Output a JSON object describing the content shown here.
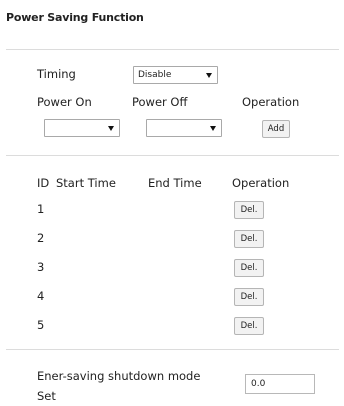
{
  "page": {
    "title": "Power Saving Function"
  },
  "timing": {
    "label": "Timing",
    "selected": "Disable"
  },
  "add_section": {
    "power_on_label": "Power On",
    "power_off_label": "Power Off",
    "operation_label": "Operation",
    "power_on_value": "",
    "power_off_value": "",
    "add_label": "Add"
  },
  "schedule_table": {
    "headers": {
      "id": "ID",
      "start_time": "Start Time",
      "end_time": "End Time",
      "operation": "Operation"
    },
    "rows": [
      {
        "id": "1",
        "del_label": "Del."
      },
      {
        "id": "2",
        "del_label": "Del."
      },
      {
        "id": "3",
        "del_label": "Del."
      },
      {
        "id": "4",
        "del_label": "Del."
      },
      {
        "id": "5",
        "del_label": "Del."
      }
    ]
  },
  "shutdown": {
    "label_line1": "Ener-saving shutdown mode",
    "label_line2": "Set",
    "value": "0.0"
  }
}
